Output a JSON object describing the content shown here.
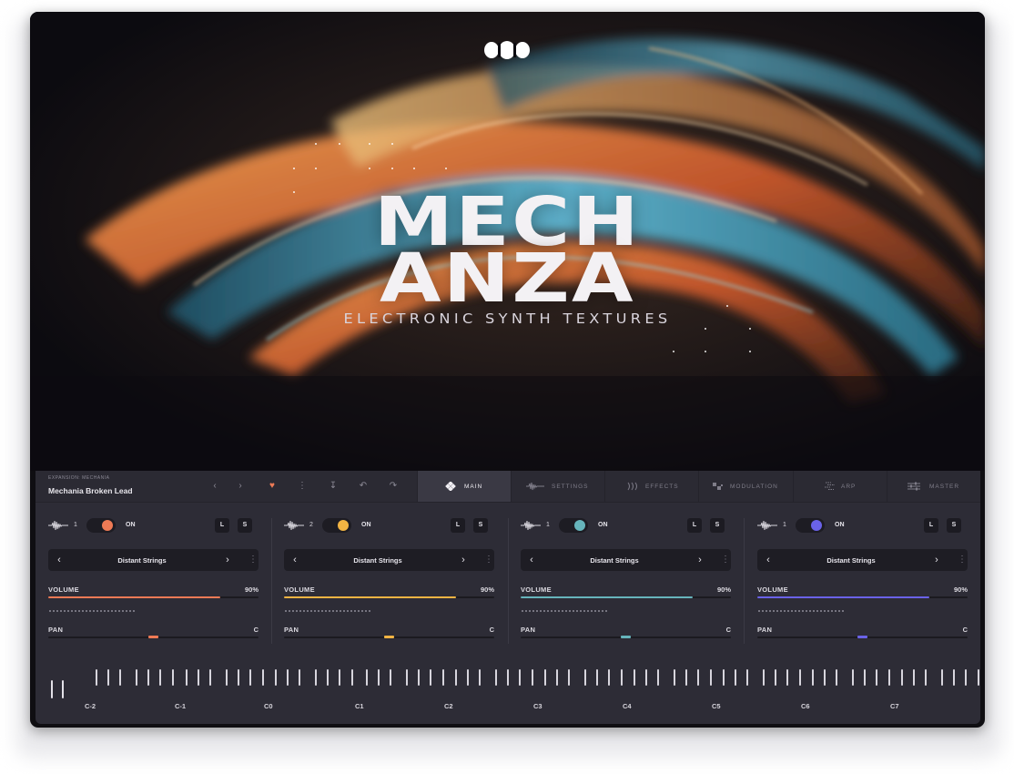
{
  "hero": {
    "title_line1": "MECH",
    "title_line2": "ANZA",
    "subtitle": "ELECTRONIC SYNTH TEXTURES"
  },
  "header": {
    "expansion_label": "EXPANSION: MECHANIA",
    "preset_name": "Mechania Broken Lead"
  },
  "tabs": [
    {
      "label": "MAIN",
      "icon": "diamond-grid-icon"
    },
    {
      "label": "SETTINGS",
      "icon": "waveform-icon"
    },
    {
      "label": "EFFECTS",
      "icon": "sound-waves-icon"
    },
    {
      "label": "MODULATION",
      "icon": "modulation-icon"
    },
    {
      "label": "ARP",
      "icon": "arp-icon"
    },
    {
      "label": "MASTER",
      "icon": "sliders-icon"
    }
  ],
  "channels": [
    {
      "number": "1",
      "on": "ON",
      "l": "L",
      "s": "S",
      "preset": "Distant Strings",
      "volume_label": "VOLUME",
      "volume_value": "90%",
      "volume_fraction": 0.82,
      "pan_label": "PAN",
      "pan_value": "C",
      "accent": "#ef7a55"
    },
    {
      "number": "2",
      "on": "ON",
      "l": "L",
      "s": "S",
      "preset": "Distant Strings",
      "volume_label": "VOLUME",
      "volume_value": "90%",
      "volume_fraction": 0.82,
      "pan_label": "PAN",
      "pan_value": "C",
      "accent": "#f2b443"
    },
    {
      "number": "1",
      "on": "ON",
      "l": "L",
      "s": "S",
      "preset": "Distant Strings",
      "volume_label": "VOLUME",
      "volume_value": "90%",
      "volume_fraction": 0.82,
      "pan_label": "PAN",
      "pan_value": "C",
      "accent": "#66b4bb"
    },
    {
      "number": "1",
      "on": "ON",
      "l": "L",
      "s": "S",
      "preset": "Distant Strings",
      "volume_label": "VOLUME",
      "volume_value": "90%",
      "volume_fraction": 0.82,
      "pan_label": "PAN",
      "pan_value": "C",
      "accent": "#6a62e8"
    }
  ],
  "keyboard": {
    "octaves": [
      "C-2",
      "C-1",
      "C0",
      "C1",
      "C2",
      "C3",
      "C4",
      "C5",
      "C6",
      "C7"
    ]
  }
}
